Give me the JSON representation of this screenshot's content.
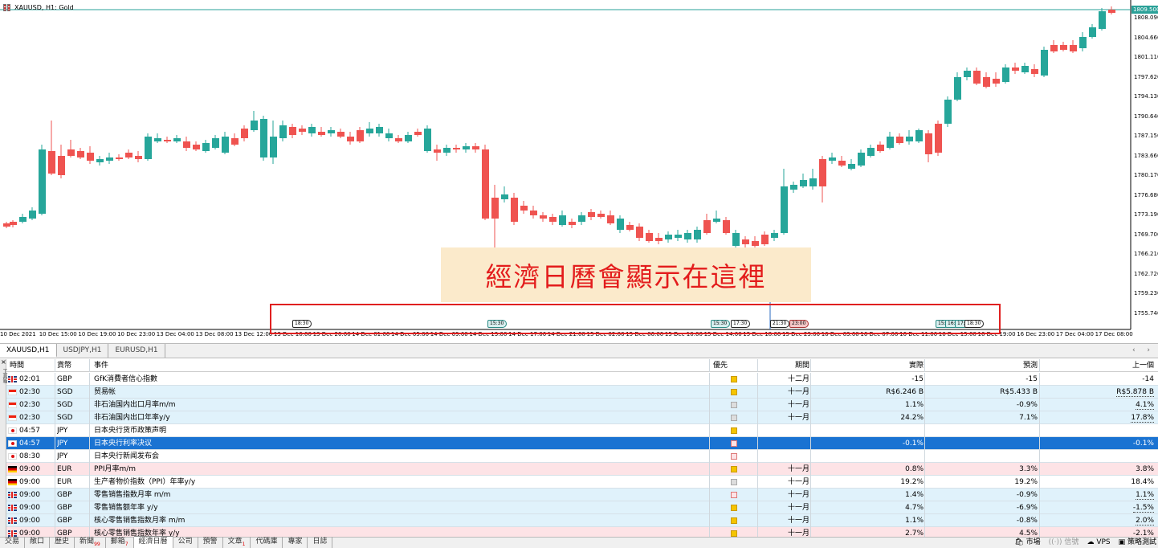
{
  "chart": {
    "title": "XAUUSD, H1:  Gold",
    "current_price": "1809.500",
    "price_labels": [
      "1808.090",
      "1804.660",
      "1801.110",
      "1797.620",
      "1794.130",
      "1790.640",
      "1787.150",
      "1783.660",
      "1780.170",
      "1776.680",
      "1773.190",
      "1769.700",
      "1766.210",
      "1762.720",
      "1759.230",
      "1755.740"
    ],
    "time_labels": [
      "10 Dec 2021",
      "10 Dec 15:00",
      "10 Dec 19:00",
      "10 Dec 23:00",
      "13 Dec 04:00",
      "13 Dec 08:00",
      "13 Dec 12:00",
      "13 Dec 16:00",
      "13 Dec 20:00",
      "14 Dec 01:00",
      "14 Dec 05:00",
      "14 Dec 09:00",
      "14 Dec 13:00",
      "14 Dec 17:00",
      "14 Dec 21:00",
      "15 Dec 02:00",
      "15 Dec 06:00",
      "15 Dec 10:00",
      "15 Dec 14:00",
      "15 Dec 18:00",
      "15 Dec 23:00",
      "16 Dec 03:00",
      "16 Dec 07:00",
      "16 Dec 11:00",
      "16 Dec 15:00",
      "16 Dec 19:00",
      "16 Dec 23:00",
      "17 Dec 04:00",
      "17 Dec 08:00"
    ],
    "event_markers": [
      {
        "label": "18:30",
        "style": "white"
      },
      {
        "label": "15:30",
        "style": "teal"
      },
      {
        "label": "15:30",
        "style": "teal"
      },
      {
        "label": "17:30",
        "style": "white"
      },
      {
        "label": "21:30",
        "style": "white"
      },
      {
        "label": "23:00",
        "style": "red"
      },
      {
        "label": "15:",
        "style": "teal"
      },
      {
        "label": "16:",
        "style": "teal"
      },
      {
        "label": "17:",
        "style": "teal"
      },
      {
        "label": "18:30",
        "style": "white"
      }
    ],
    "banner_text": "經濟日曆會顯示在這裡",
    "up_color": "#26a69a",
    "down_color": "#ef5350"
  },
  "chart_tabs": [
    "XAUUSD,H1",
    "USDJPY,H1",
    "EURUSD,H1"
  ],
  "toolbox": {
    "close": "×",
    "vertical_label": "工具箱"
  },
  "calendar": {
    "headers": {
      "time": "時間",
      "currency": "貨幣",
      "event": "事件",
      "priority": "優先",
      "period": "期間",
      "actual": "實際",
      "forecast": "預測",
      "previous": "上一個"
    },
    "rows": [
      {
        "flag": "gb",
        "time": "02:01",
        "currency": "GBP",
        "event": "GfK消費者信心指數",
        "priority": "yellow",
        "period": "十二月",
        "actual": "-15",
        "forecast": "-15",
        "previous": "-14",
        "prev_underline": false,
        "bg": "white"
      },
      {
        "flag": "sg",
        "time": "02:30",
        "currency": "SGD",
        "event": "贸易帐",
        "priority": "yellow",
        "period": "十一月",
        "actual": "R$6.246 B",
        "forecast": "R$5.433 B",
        "previous": "R$5.878 B",
        "prev_underline": true,
        "bg": "blue"
      },
      {
        "flag": "sg",
        "time": "02:30",
        "currency": "SGD",
        "event": "非石油国内出口月率m/m",
        "priority": "gray",
        "period": "十一月",
        "actual": "1.1%",
        "forecast": "-0.9%",
        "previous": "4.1%",
        "prev_underline": true,
        "bg": "blue"
      },
      {
        "flag": "sg",
        "time": "02:30",
        "currency": "SGD",
        "event": "非石油国内出口年率y/y",
        "priority": "gray",
        "period": "十一月",
        "actual": "24.2%",
        "forecast": "7.1%",
        "previous": "17.8%",
        "prev_underline": true,
        "bg": "blue"
      },
      {
        "flag": "jp",
        "time": "04:57",
        "currency": "JPY",
        "event": "日本央行货币政策声明",
        "priority": "yellow",
        "period": "",
        "actual": "",
        "forecast": "",
        "previous": "",
        "prev_underline": false,
        "bg": "white"
      },
      {
        "flag": "jp",
        "time": "04:57",
        "currency": "JPY",
        "event": "日本央行利率决议",
        "priority": "pinkbox",
        "period": "",
        "actual": "-0.1%",
        "forecast": "",
        "previous": "-0.1%",
        "prev_underline": false,
        "bg": "sel"
      },
      {
        "flag": "jp",
        "time": "08:30",
        "currency": "JPY",
        "event": "日本央行新闻发布会",
        "priority": "pinkbox",
        "period": "",
        "actual": "",
        "forecast": "",
        "previous": "",
        "prev_underline": false,
        "bg": "white"
      },
      {
        "flag": "de",
        "time": "09:00",
        "currency": "EUR",
        "event": "PPI月率m/m",
        "priority": "yellow",
        "period": "十一月",
        "actual": "0.8%",
        "forecast": "3.3%",
        "previous": "3.8%",
        "prev_underline": false,
        "bg": "pink"
      },
      {
        "flag": "de",
        "time": "09:00",
        "currency": "EUR",
        "event": "生产者物价指数（PPI）年率y/y",
        "priority": "gray",
        "period": "十一月",
        "actual": "19.2%",
        "forecast": "19.2%",
        "previous": "18.4%",
        "prev_underline": false,
        "bg": "white"
      },
      {
        "flag": "gb",
        "time": "09:00",
        "currency": "GBP",
        "event": "零售销售指数月率 m/m",
        "priority": "pinkbox",
        "period": "十一月",
        "actual": "1.4%",
        "forecast": "-0.9%",
        "previous": "1.1%",
        "prev_underline": true,
        "bg": "blue"
      },
      {
        "flag": "gb",
        "time": "09:00",
        "currency": "GBP",
        "event": "零售销售额年率 y/y",
        "priority": "yellow",
        "period": "十一月",
        "actual": "4.7%",
        "forecast": "-6.9%",
        "previous": "-1.5%",
        "prev_underline": true,
        "bg": "blue"
      },
      {
        "flag": "gb",
        "time": "09:00",
        "currency": "GBP",
        "event": "核心零售销售指数月率 m/m",
        "priority": "yellow",
        "period": "十一月",
        "actual": "1.1%",
        "forecast": "-0.8%",
        "previous": "2.0%",
        "prev_underline": true,
        "bg": "blue"
      },
      {
        "flag": "gb",
        "time": "09:00",
        "currency": "GBP",
        "event": "核心零售销售指数年率 y/y",
        "priority": "yellow",
        "period": "十一月",
        "actual": "2.7%",
        "forecast": "4.5%",
        "previous": "-2.1%",
        "prev_underline": true,
        "bg": "pink"
      }
    ]
  },
  "bottom_tabs": [
    {
      "label": "交易",
      "badge": ""
    },
    {
      "label": "敞口",
      "badge": ""
    },
    {
      "label": "歷史",
      "badge": ""
    },
    {
      "label": "新聞",
      "badge": "99"
    },
    {
      "label": "郵箱",
      "badge": "7"
    },
    {
      "label": "經濟日曆",
      "badge": "",
      "active": true
    },
    {
      "label": "公司",
      "badge": ""
    },
    {
      "label": "預警",
      "badge": ""
    },
    {
      "label": "文章",
      "badge": "1"
    },
    {
      "label": "代碼庫",
      "badge": ""
    },
    {
      "label": "專家",
      "badge": ""
    },
    {
      "label": "日誌",
      "badge": ""
    }
  ],
  "status": {
    "market": "市場",
    "signals": "信號",
    "vps": "VPS",
    "tester": "策略測試"
  }
}
